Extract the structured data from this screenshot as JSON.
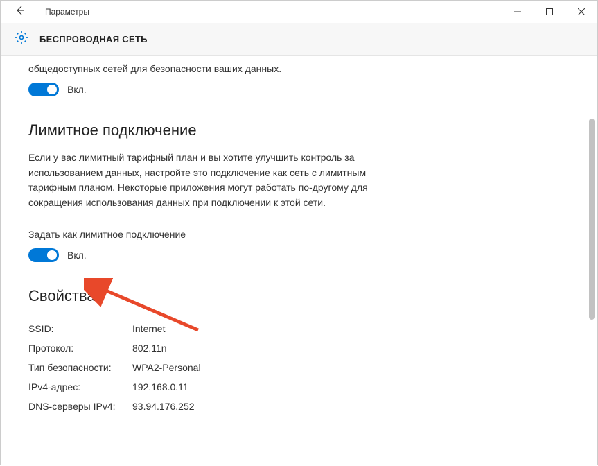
{
  "titlebar": {
    "back_icon": "←",
    "app_title": "Параметры"
  },
  "header": {
    "page_title": "БЕСПРОВОДНАЯ СЕТЬ"
  },
  "content": {
    "prev_text_fragment": "общедоступных сетей для безопасности ваших данных.",
    "toggle1_state": "Вкл.",
    "section1_title": "Лимитное подключение",
    "section1_desc": "Если у вас лимитный тарифный план и вы хотите улучшить контроль за использованием данных, настройте это подключение как сеть с лимитным тарифным планом. Некоторые приложения могут работать по-другому для сокращения использования данных при подключении к этой сети.",
    "metered_label": "Задать как лимитное подключение",
    "toggle2_state": "Вкл.",
    "section2_title": "Свойства",
    "properties": [
      {
        "key": "SSID:",
        "value": "Internet"
      },
      {
        "key": "Протокол:",
        "value": "802.11n"
      },
      {
        "key": "Тип безопасности:",
        "value": "WPA2-Personal"
      },
      {
        "key": "IPv4-адрес:",
        "value": "192.168.0.11"
      },
      {
        "key": "DNS-серверы IPv4:",
        "value": "93.94.176.252"
      }
    ]
  },
  "colors": {
    "accent": "#0078d7",
    "arrow": "#e8482a"
  }
}
